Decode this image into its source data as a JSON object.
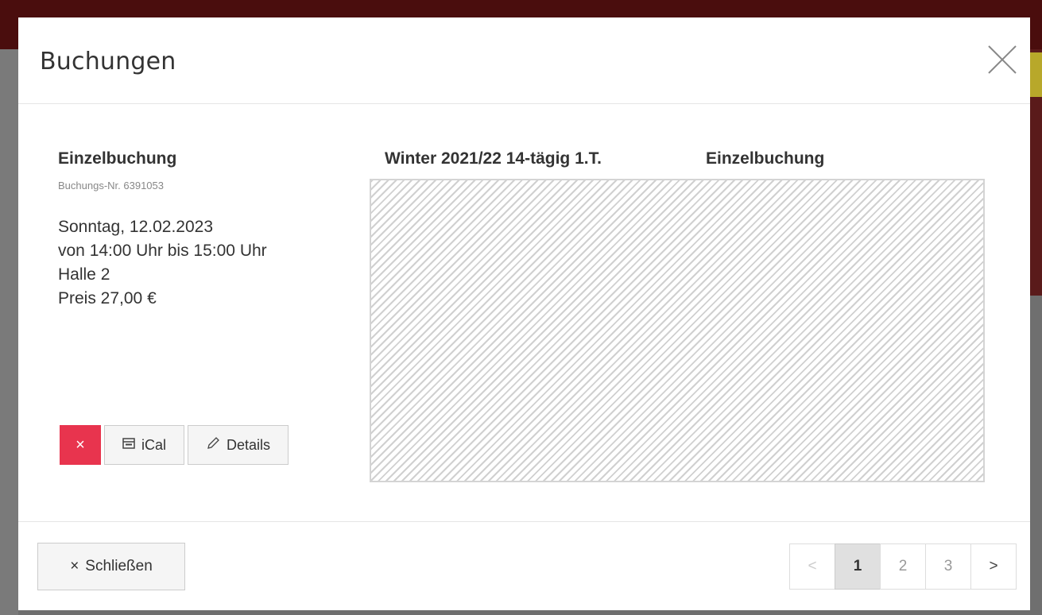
{
  "modal": {
    "title": "Buchungen",
    "close_icon": "close-icon"
  },
  "booking": {
    "type": "Einzelbuchung",
    "number": "Buchungs-Nr. 6391053",
    "date": "Sonntag, 12.02.2023",
    "time": "von 14:00 Uhr bis 15:00 Uhr",
    "hall": "Halle 2",
    "price": "Preis 27,00 €"
  },
  "actions": {
    "delete_label": "×",
    "ical_label": "iCal",
    "details_label": "Details"
  },
  "legend": {
    "season": "Winter 2021/22 14-tägig 1.T.",
    "single": "Einzelbuchung"
  },
  "footer": {
    "close_label": "Schließen",
    "close_glyph": "×"
  },
  "pagination": {
    "prev": "<",
    "pages": [
      "1",
      "2",
      "3"
    ],
    "next": ">",
    "active_page": "1"
  },
  "colors": {
    "delete": "#e8344e",
    "active_page": "#e0e0e0"
  }
}
